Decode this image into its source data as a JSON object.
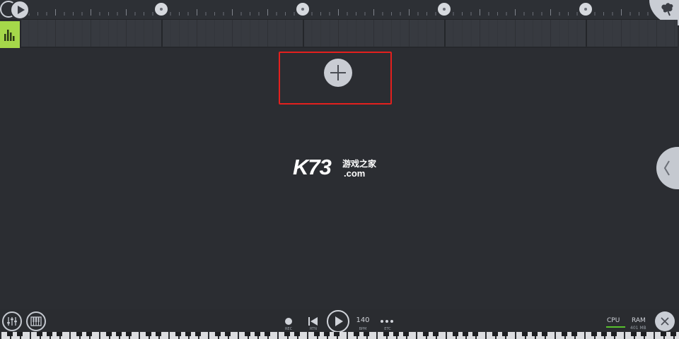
{
  "colors": {
    "background": "#2b2d32",
    "track_accent": "#a5d84a",
    "highlight_box": "#e4201e",
    "control_fill": "#c9cdd4",
    "cpu_meter": "#58c22e"
  },
  "icons": {
    "timeline_play": "play-icon",
    "top_right_button": "fl-logo-icon",
    "track": "sampler-icon",
    "add_track": "plus-icon",
    "side_panel": "chevron-left-icon",
    "mixer": "mixer-icon",
    "piano": "piano-icon",
    "record": "record-icon",
    "rewind": "skip-back-icon",
    "play": "play-icon",
    "more": "more-icon",
    "close": "close-icon"
  },
  "watermark": {
    "brand": "K73",
    "name": "游戏之家",
    "domain": ".com"
  },
  "transport": {
    "record_label": "REC",
    "rewind_label": "RTN",
    "tempo": "140",
    "tempo_label": "BPM",
    "more_label": "ETC"
  },
  "status": {
    "cpu_label": "CPU",
    "cpu_meter_level": 1.0,
    "ram_label": "RAM",
    "ram_value": "401 MB"
  }
}
